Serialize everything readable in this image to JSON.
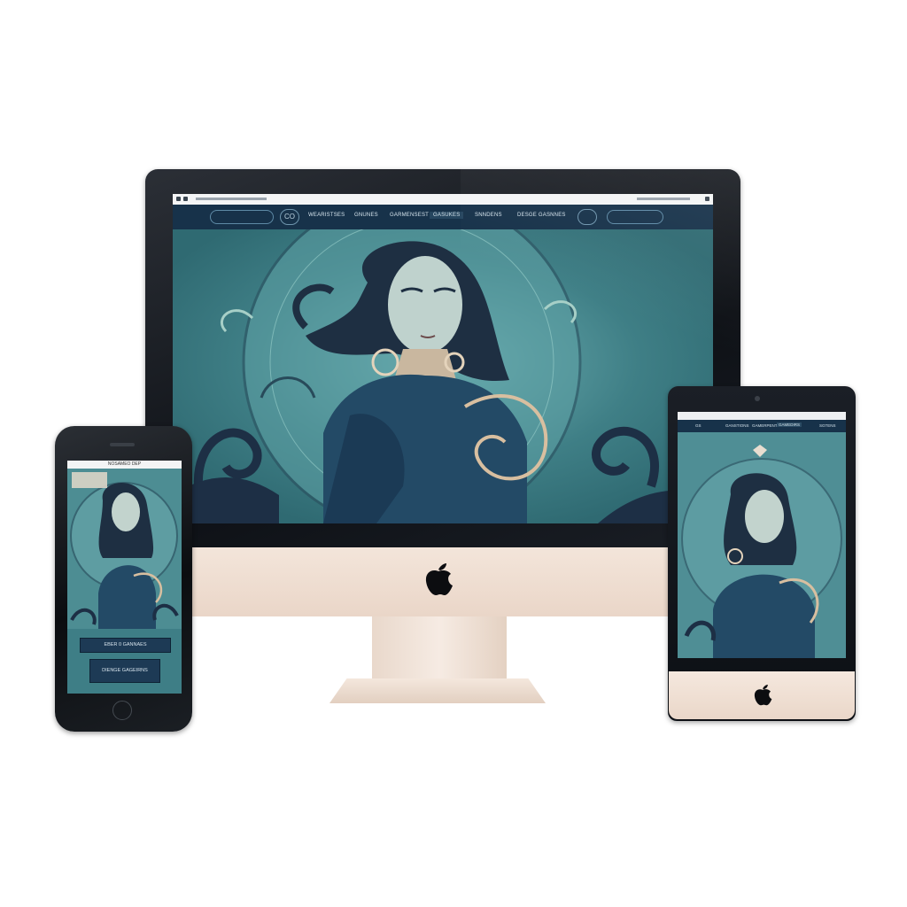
{
  "desktop": {
    "nav_icon_glyph": "CO",
    "nav_items": [
      "WEARISTSES",
      "GNUNES",
      "GARMENSEST",
      "GASUKES",
      "SNNDENS",
      "DESGE GASNNES"
    ]
  },
  "phone": {
    "status_title": "NOSAMEO DEP",
    "buttons": [
      "EBER 0 GANNAES",
      "DIENGE GAGEIRNS"
    ]
  },
  "tablet": {
    "nav_items": [
      "GS",
      "GANSTIONS",
      "GAMERPENTS",
      "GAMEDIRS",
      "SGTENS"
    ]
  },
  "colors": {
    "nav_bg": "#17324a",
    "art_teal": "#3f7f86",
    "device_silver": "#f0e2d7",
    "bezel": "#111418"
  },
  "icons": [
    "apple-logo-icon",
    "home-button-icon",
    "camera-icon"
  ]
}
